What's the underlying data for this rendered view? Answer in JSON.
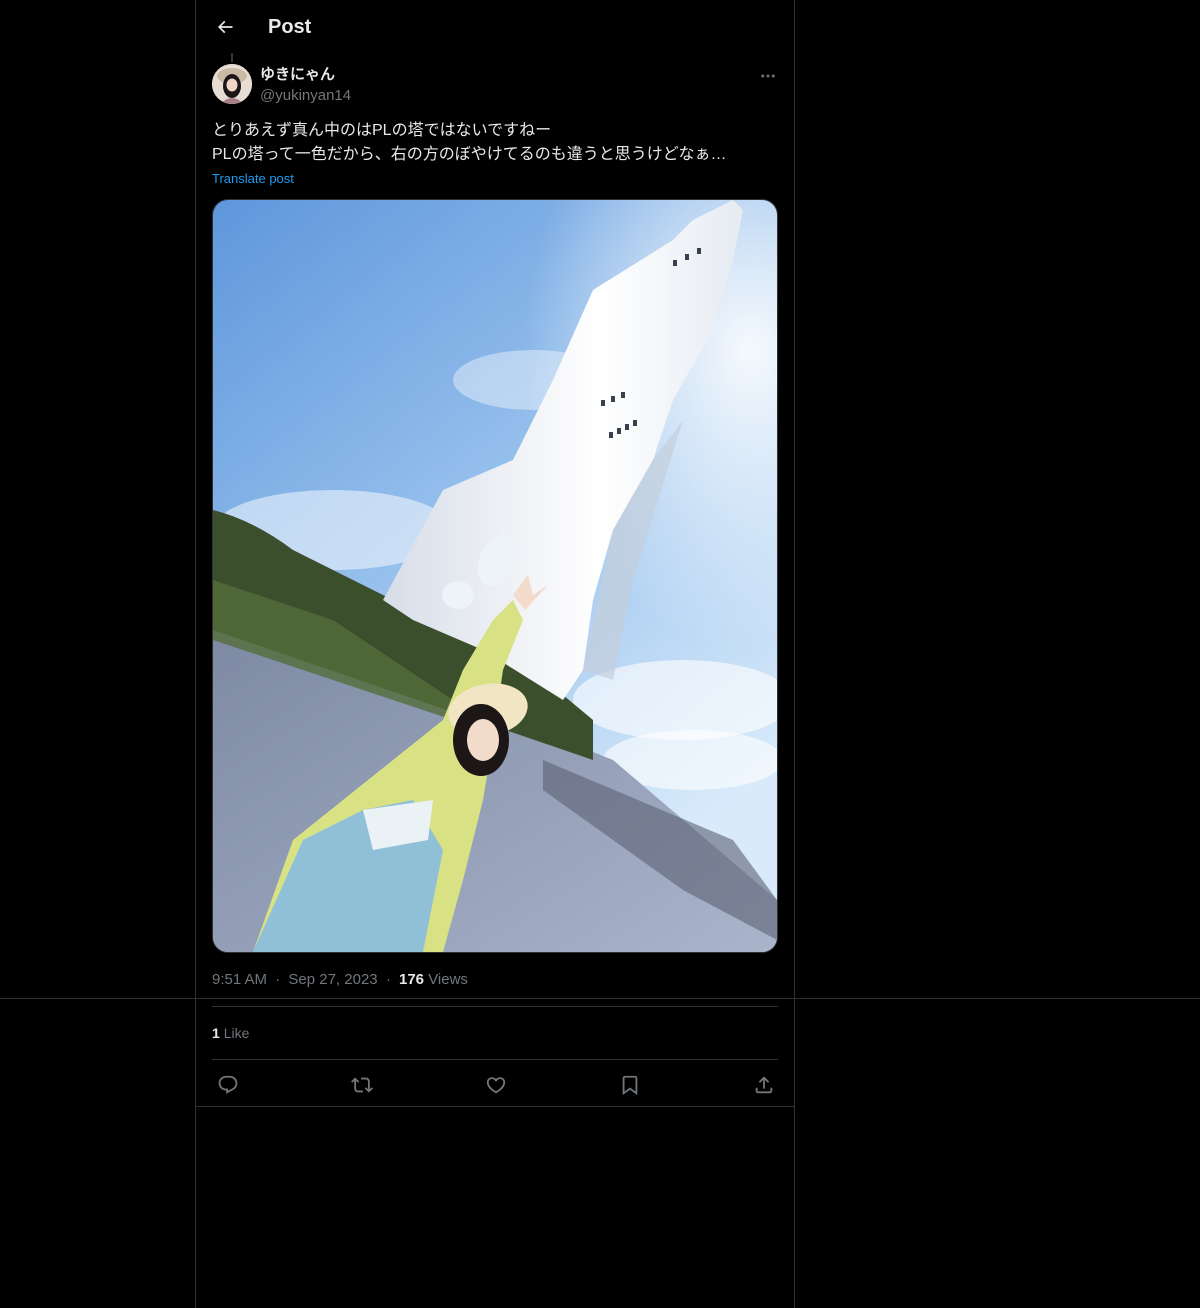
{
  "header": {
    "title": "Post",
    "back_icon": "arrow-left-icon"
  },
  "author": {
    "display_name": "ゆきにゃん",
    "handle": "@yukinyan14",
    "avatar_icon": "avatar"
  },
  "post": {
    "lines": [
      "とりあえず真ん中のはPLの塔ではないですねー",
      "PLの塔って一色だから、右の方のぼやけてるのも違うと思うけどなぁ…"
    ],
    "translate_label": "Translate post"
  },
  "meta": {
    "time": "9:51 AM",
    "separator": "·",
    "date": "Sep 27, 2023",
    "views_count": "176",
    "views_label": "Views"
  },
  "engagement": {
    "likes_count": "1",
    "likes_label": "Like"
  },
  "actions": [
    {
      "name": "reply-icon"
    },
    {
      "name": "repost-icon"
    },
    {
      "name": "like-icon"
    },
    {
      "name": "bookmark-icon"
    },
    {
      "name": "share-icon"
    }
  ],
  "colors": {
    "background": "#000000",
    "text": "#e7e9ea",
    "secondary": "#71767b",
    "link": "#1d9bf0",
    "border": "#2f3336"
  }
}
